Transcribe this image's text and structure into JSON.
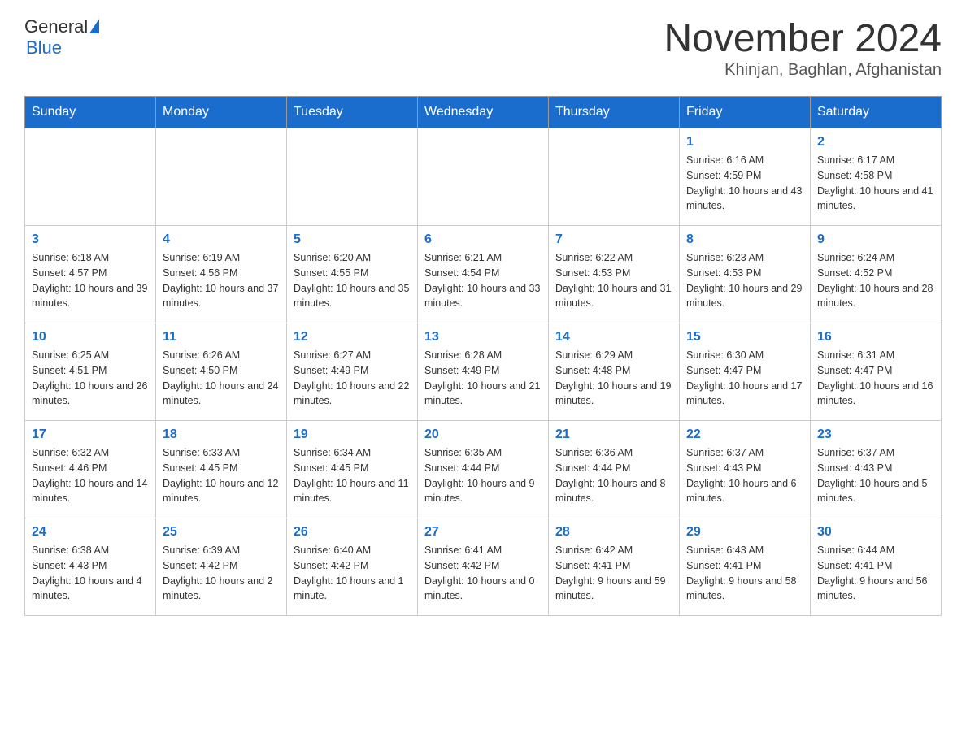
{
  "header": {
    "logo_line1": "General",
    "logo_line2": "Blue",
    "month_title": "November 2024",
    "location": "Khinjan, Baghlan, Afghanistan"
  },
  "weekdays": [
    "Sunday",
    "Monday",
    "Tuesday",
    "Wednesday",
    "Thursday",
    "Friday",
    "Saturday"
  ],
  "weeks": [
    [
      {
        "day": "",
        "sunrise": "",
        "sunset": "",
        "daylight": ""
      },
      {
        "day": "",
        "sunrise": "",
        "sunset": "",
        "daylight": ""
      },
      {
        "day": "",
        "sunrise": "",
        "sunset": "",
        "daylight": ""
      },
      {
        "day": "",
        "sunrise": "",
        "sunset": "",
        "daylight": ""
      },
      {
        "day": "",
        "sunrise": "",
        "sunset": "",
        "daylight": ""
      },
      {
        "day": "1",
        "sunrise": "Sunrise: 6:16 AM",
        "sunset": "Sunset: 4:59 PM",
        "daylight": "Daylight: 10 hours and 43 minutes."
      },
      {
        "day": "2",
        "sunrise": "Sunrise: 6:17 AM",
        "sunset": "Sunset: 4:58 PM",
        "daylight": "Daylight: 10 hours and 41 minutes."
      }
    ],
    [
      {
        "day": "3",
        "sunrise": "Sunrise: 6:18 AM",
        "sunset": "Sunset: 4:57 PM",
        "daylight": "Daylight: 10 hours and 39 minutes."
      },
      {
        "day": "4",
        "sunrise": "Sunrise: 6:19 AM",
        "sunset": "Sunset: 4:56 PM",
        "daylight": "Daylight: 10 hours and 37 minutes."
      },
      {
        "day": "5",
        "sunrise": "Sunrise: 6:20 AM",
        "sunset": "Sunset: 4:55 PM",
        "daylight": "Daylight: 10 hours and 35 minutes."
      },
      {
        "day": "6",
        "sunrise": "Sunrise: 6:21 AM",
        "sunset": "Sunset: 4:54 PM",
        "daylight": "Daylight: 10 hours and 33 minutes."
      },
      {
        "day": "7",
        "sunrise": "Sunrise: 6:22 AM",
        "sunset": "Sunset: 4:53 PM",
        "daylight": "Daylight: 10 hours and 31 minutes."
      },
      {
        "day": "8",
        "sunrise": "Sunrise: 6:23 AM",
        "sunset": "Sunset: 4:53 PM",
        "daylight": "Daylight: 10 hours and 29 minutes."
      },
      {
        "day": "9",
        "sunrise": "Sunrise: 6:24 AM",
        "sunset": "Sunset: 4:52 PM",
        "daylight": "Daylight: 10 hours and 28 minutes."
      }
    ],
    [
      {
        "day": "10",
        "sunrise": "Sunrise: 6:25 AM",
        "sunset": "Sunset: 4:51 PM",
        "daylight": "Daylight: 10 hours and 26 minutes."
      },
      {
        "day": "11",
        "sunrise": "Sunrise: 6:26 AM",
        "sunset": "Sunset: 4:50 PM",
        "daylight": "Daylight: 10 hours and 24 minutes."
      },
      {
        "day": "12",
        "sunrise": "Sunrise: 6:27 AM",
        "sunset": "Sunset: 4:49 PM",
        "daylight": "Daylight: 10 hours and 22 minutes."
      },
      {
        "day": "13",
        "sunrise": "Sunrise: 6:28 AM",
        "sunset": "Sunset: 4:49 PM",
        "daylight": "Daylight: 10 hours and 21 minutes."
      },
      {
        "day": "14",
        "sunrise": "Sunrise: 6:29 AM",
        "sunset": "Sunset: 4:48 PM",
        "daylight": "Daylight: 10 hours and 19 minutes."
      },
      {
        "day": "15",
        "sunrise": "Sunrise: 6:30 AM",
        "sunset": "Sunset: 4:47 PM",
        "daylight": "Daylight: 10 hours and 17 minutes."
      },
      {
        "day": "16",
        "sunrise": "Sunrise: 6:31 AM",
        "sunset": "Sunset: 4:47 PM",
        "daylight": "Daylight: 10 hours and 16 minutes."
      }
    ],
    [
      {
        "day": "17",
        "sunrise": "Sunrise: 6:32 AM",
        "sunset": "Sunset: 4:46 PM",
        "daylight": "Daylight: 10 hours and 14 minutes."
      },
      {
        "day": "18",
        "sunrise": "Sunrise: 6:33 AM",
        "sunset": "Sunset: 4:45 PM",
        "daylight": "Daylight: 10 hours and 12 minutes."
      },
      {
        "day": "19",
        "sunrise": "Sunrise: 6:34 AM",
        "sunset": "Sunset: 4:45 PM",
        "daylight": "Daylight: 10 hours and 11 minutes."
      },
      {
        "day": "20",
        "sunrise": "Sunrise: 6:35 AM",
        "sunset": "Sunset: 4:44 PM",
        "daylight": "Daylight: 10 hours and 9 minutes."
      },
      {
        "day": "21",
        "sunrise": "Sunrise: 6:36 AM",
        "sunset": "Sunset: 4:44 PM",
        "daylight": "Daylight: 10 hours and 8 minutes."
      },
      {
        "day": "22",
        "sunrise": "Sunrise: 6:37 AM",
        "sunset": "Sunset: 4:43 PM",
        "daylight": "Daylight: 10 hours and 6 minutes."
      },
      {
        "day": "23",
        "sunrise": "Sunrise: 6:37 AM",
        "sunset": "Sunset: 4:43 PM",
        "daylight": "Daylight: 10 hours and 5 minutes."
      }
    ],
    [
      {
        "day": "24",
        "sunrise": "Sunrise: 6:38 AM",
        "sunset": "Sunset: 4:43 PM",
        "daylight": "Daylight: 10 hours and 4 minutes."
      },
      {
        "day": "25",
        "sunrise": "Sunrise: 6:39 AM",
        "sunset": "Sunset: 4:42 PM",
        "daylight": "Daylight: 10 hours and 2 minutes."
      },
      {
        "day": "26",
        "sunrise": "Sunrise: 6:40 AM",
        "sunset": "Sunset: 4:42 PM",
        "daylight": "Daylight: 10 hours and 1 minute."
      },
      {
        "day": "27",
        "sunrise": "Sunrise: 6:41 AM",
        "sunset": "Sunset: 4:42 PM",
        "daylight": "Daylight: 10 hours and 0 minutes."
      },
      {
        "day": "28",
        "sunrise": "Sunrise: 6:42 AM",
        "sunset": "Sunset: 4:41 PM",
        "daylight": "Daylight: 9 hours and 59 minutes."
      },
      {
        "day": "29",
        "sunrise": "Sunrise: 6:43 AM",
        "sunset": "Sunset: 4:41 PM",
        "daylight": "Daylight: 9 hours and 58 minutes."
      },
      {
        "day": "30",
        "sunrise": "Sunrise: 6:44 AM",
        "sunset": "Sunset: 4:41 PM",
        "daylight": "Daylight: 9 hours and 56 minutes."
      }
    ]
  ]
}
